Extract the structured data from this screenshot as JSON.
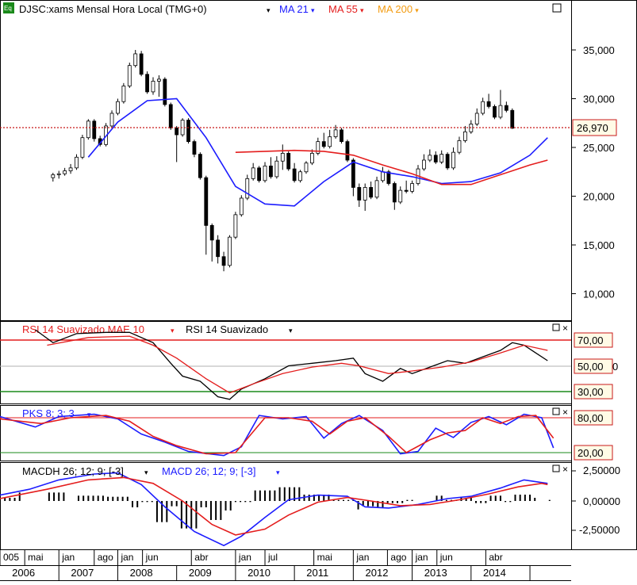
{
  "instrument_title": "DJSC:xams Mensal Hora Local (TMG+0)",
  "app_badge": "Eq",
  "colors": {
    "background": "#ffffff",
    "candle_up": "#ffffff",
    "candle_down": "#000000",
    "ma21": "#1c1cff",
    "ma55": "#e41d1d",
    "ma200": "#f39c12",
    "last_price": "#c81919",
    "last_price_fill": "#fffbe6",
    "rsi_bound_high": "#e41d1d",
    "rsi_bound_low": "#1a8a1a",
    "grid_mid": "#b0b0b0",
    "label_box": "#c81919"
  },
  "legend_main": [
    {
      "label": "MA 21",
      "color": "#1c1cff"
    },
    {
      "label": "MA 55",
      "color": "#e41d1d"
    },
    {
      "label": "MA 200",
      "color": "#f39c12"
    }
  ],
  "last_price_label": "26,970",
  "main_axis_ticks": [
    "35,000",
    "30,000",
    "25,000",
    "20,000",
    "15,000",
    "10,000"
  ],
  "rsi_panel": {
    "legend": [
      {
        "label": "RSI 14 Suavizado MAE 10",
        "color": "#e41d1d"
      },
      {
        "label": "RSI 14 Suavizado",
        "color": "#000000"
      }
    ],
    "ticks": [
      "70,00",
      "50,00",
      "30,00"
    ],
    "extra_tick_fragment": "0"
  },
  "stoch_panel": {
    "legend": [
      {
        "label": "PKS 8; 3; 3",
        "color": "#1c1cff"
      }
    ],
    "ticks": [
      "80,00",
      "20,00"
    ]
  },
  "macd_panel": {
    "legend": [
      {
        "label": "MACDH 26; 12; 9; [-3]",
        "color": "#000000"
      },
      {
        "label": "MACD 26; 12; 9; [-3]",
        "color": "#1c1cff"
      }
    ],
    "ticks": [
      "2,50000",
      "0,00000",
      "-2,50000"
    ]
  },
  "time_axis": {
    "months": [
      "005",
      "mai",
      "jan",
      "ago",
      "jan",
      "jun",
      "abr",
      "jan",
      "jul",
      "mai",
      "jan",
      "ago",
      "jan",
      "jun",
      "abr"
    ],
    "years": [
      "2006",
      "2007",
      "2008",
      "2009",
      "2010",
      "2011",
      "2012",
      "2013",
      "2014"
    ]
  },
  "panel_buttons": [
    "□",
    "×"
  ],
  "chart_data": {
    "type": "candlestick",
    "price_range": [
      6000,
      40000
    ],
    "timeframe": "monthly",
    "last_price": 26970,
    "series": [
      {
        "name": "MA 21",
        "points": [
          [
            2006.5,
            24000
          ],
          [
            2007.0,
            27600
          ],
          [
            2007.5,
            29800
          ],
          [
            2008.0,
            30000
          ],
          [
            2008.5,
            26000
          ],
          [
            2009.0,
            21000
          ],
          [
            2009.5,
            19200
          ],
          [
            2010.0,
            19000
          ],
          [
            2010.5,
            21500
          ],
          [
            2011.0,
            23500
          ],
          [
            2011.5,
            22500
          ],
          [
            2012.0,
            22000
          ],
          [
            2012.5,
            21300
          ],
          [
            2013.0,
            21500
          ],
          [
            2013.5,
            22400
          ],
          [
            2014.0,
            24200
          ],
          [
            2014.3,
            26000
          ]
        ]
      },
      {
        "name": "MA 55",
        "points": [
          [
            2009.0,
            24500
          ],
          [
            2009.5,
            24600
          ],
          [
            2010.0,
            24700
          ],
          [
            2010.5,
            24600
          ],
          [
            2011.0,
            24200
          ],
          [
            2011.5,
            23200
          ],
          [
            2012.0,
            22300
          ],
          [
            2012.5,
            21200
          ],
          [
            2013.0,
            21200
          ],
          [
            2013.5,
            22200
          ],
          [
            2014.0,
            23200
          ],
          [
            2014.3,
            23700
          ]
        ]
      }
    ],
    "candles": [
      [
        2005.9,
        21900,
        22200,
        21500,
        22400
      ],
      [
        2006.0,
        22200,
        22300,
        21800,
        22600
      ],
      [
        2006.1,
        22300,
        22600,
        22100,
        22900
      ],
      [
        2006.2,
        22600,
        22900,
        22300,
        23300
      ],
      [
        2006.3,
        22900,
        24000,
        22700,
        24300
      ],
      [
        2006.4,
        24000,
        26000,
        23800,
        26300
      ],
      [
        2006.5,
        26000,
        27700,
        25800,
        27900
      ],
      [
        2006.6,
        27700,
        25900,
        25600,
        27900
      ],
      [
        2006.7,
        25900,
        25300,
        25100,
        26200
      ],
      [
        2006.8,
        25300,
        27200,
        25100,
        27500
      ],
      [
        2006.9,
        27200,
        28500,
        27000,
        28800
      ],
      [
        2007.0,
        28500,
        29700,
        28300,
        30000
      ],
      [
        2007.1,
        29700,
        31300,
        29500,
        31600
      ],
      [
        2007.2,
        31300,
        33400,
        31100,
        33700
      ],
      [
        2007.3,
        33400,
        34600,
        33200,
        35000
      ],
      [
        2007.4,
        34600,
        32500,
        32300,
        34900
      ],
      [
        2007.5,
        32500,
        30700,
        30500,
        32800
      ],
      [
        2007.6,
        30700,
        31800,
        30400,
        32200
      ],
      [
        2007.7,
        31800,
        32000,
        30200,
        32400
      ],
      [
        2007.8,
        32000,
        29400,
        29200,
        32200
      ],
      [
        2007.9,
        29400,
        27000,
        26800,
        29600
      ],
      [
        2008.0,
        27000,
        26300,
        23500,
        27200
      ],
      [
        2008.1,
        26300,
        27800,
        26100,
        28000
      ],
      [
        2008.2,
        27800,
        25600,
        25400,
        28000
      ],
      [
        2008.3,
        25600,
        24300,
        24000,
        25800
      ],
      [
        2008.4,
        24300,
        21900,
        21700,
        24500
      ],
      [
        2008.5,
        21900,
        17000,
        14000,
        22100
      ],
      [
        2008.6,
        17000,
        15500,
        13300,
        17200
      ],
      [
        2008.7,
        15500,
        13800,
        13100,
        16000
      ],
      [
        2008.8,
        13800,
        12900,
        12300,
        14300
      ],
      [
        2008.9,
        12900,
        15800,
        12700,
        16000
      ],
      [
        2009.0,
        15800,
        18100,
        15600,
        18400
      ],
      [
        2009.1,
        18100,
        19800,
        17900,
        20100
      ],
      [
        2009.2,
        19800,
        21800,
        19600,
        22200
      ],
      [
        2009.3,
        21800,
        22900,
        21600,
        23400
      ],
      [
        2009.4,
        22900,
        21600,
        21400,
        23100
      ],
      [
        2009.5,
        21600,
        23100,
        21400,
        23500
      ],
      [
        2009.6,
        23100,
        22000,
        21800,
        24000
      ],
      [
        2009.7,
        22000,
        23600,
        21800,
        24100
      ],
      [
        2009.8,
        23600,
        24400,
        22700,
        25300
      ],
      [
        2009.9,
        24400,
        22800,
        22600,
        24600
      ],
      [
        2010.0,
        22800,
        21600,
        21400,
        23400
      ],
      [
        2010.1,
        21600,
        22500,
        21400,
        22700
      ],
      [
        2010.2,
        22500,
        23400,
        22300,
        23600
      ],
      [
        2010.3,
        23400,
        24400,
        23200,
        24800
      ],
      [
        2010.4,
        24400,
        25600,
        24200,
        26000
      ],
      [
        2010.5,
        25600,
        25100,
        24900,
        26500
      ],
      [
        2010.6,
        25100,
        26100,
        24900,
        26800
      ],
      [
        2010.7,
        26100,
        26800,
        25900,
        27300
      ],
      [
        2010.8,
        26800,
        25600,
        25400,
        27000
      ],
      [
        2010.9,
        25600,
        23700,
        23500,
        25800
      ],
      [
        2011.0,
        23700,
        20900,
        20000,
        23900
      ],
      [
        2011.1,
        20900,
        19600,
        18900,
        21300
      ],
      [
        2011.2,
        19600,
        20900,
        18500,
        21300
      ],
      [
        2011.3,
        20900,
        19900,
        19700,
        21500
      ],
      [
        2011.4,
        19900,
        21600,
        19700,
        22000
      ],
      [
        2011.5,
        21600,
        22500,
        21400,
        23000
      ],
      [
        2011.6,
        22500,
        21300,
        21100,
        22700
      ],
      [
        2011.7,
        21300,
        19400,
        18600,
        21500
      ],
      [
        2011.8,
        19400,
        20600,
        19200,
        21000
      ],
      [
        2011.9,
        20600,
        20500,
        20300,
        21600
      ],
      [
        2012.0,
        20500,
        21300,
        20300,
        21600
      ],
      [
        2012.1,
        21300,
        22800,
        21100,
        23200
      ],
      [
        2012.2,
        22800,
        23700,
        22600,
        24300
      ],
      [
        2012.3,
        23700,
        24200,
        23500,
        24800
      ],
      [
        2012.4,
        24200,
        23500,
        23300,
        24600
      ],
      [
        2012.5,
        23500,
        24300,
        23300,
        24700
      ],
      [
        2012.6,
        24300,
        22900,
        22700,
        24500
      ],
      [
        2012.7,
        22900,
        24500,
        22700,
        25000
      ],
      [
        2012.8,
        24500,
        25700,
        24300,
        26100
      ],
      [
        2012.9,
        25700,
        26600,
        25500,
        27200
      ],
      [
        2013.0,
        26600,
        27400,
        26400,
        27800
      ],
      [
        2013.1,
        27400,
        28500,
        27200,
        29000
      ],
      [
        2013.2,
        28500,
        29700,
        28300,
        30100
      ],
      [
        2013.3,
        29700,
        29200,
        29000,
        30500
      ],
      [
        2013.4,
        29200,
        28100,
        27900,
        29400
      ],
      [
        2013.5,
        28100,
        29300,
        27900,
        30900
      ],
      [
        2013.6,
        29300,
        28800,
        28600,
        29700
      ],
      [
        2013.7,
        28800,
        26970,
        26900,
        29000
      ]
    ]
  }
}
